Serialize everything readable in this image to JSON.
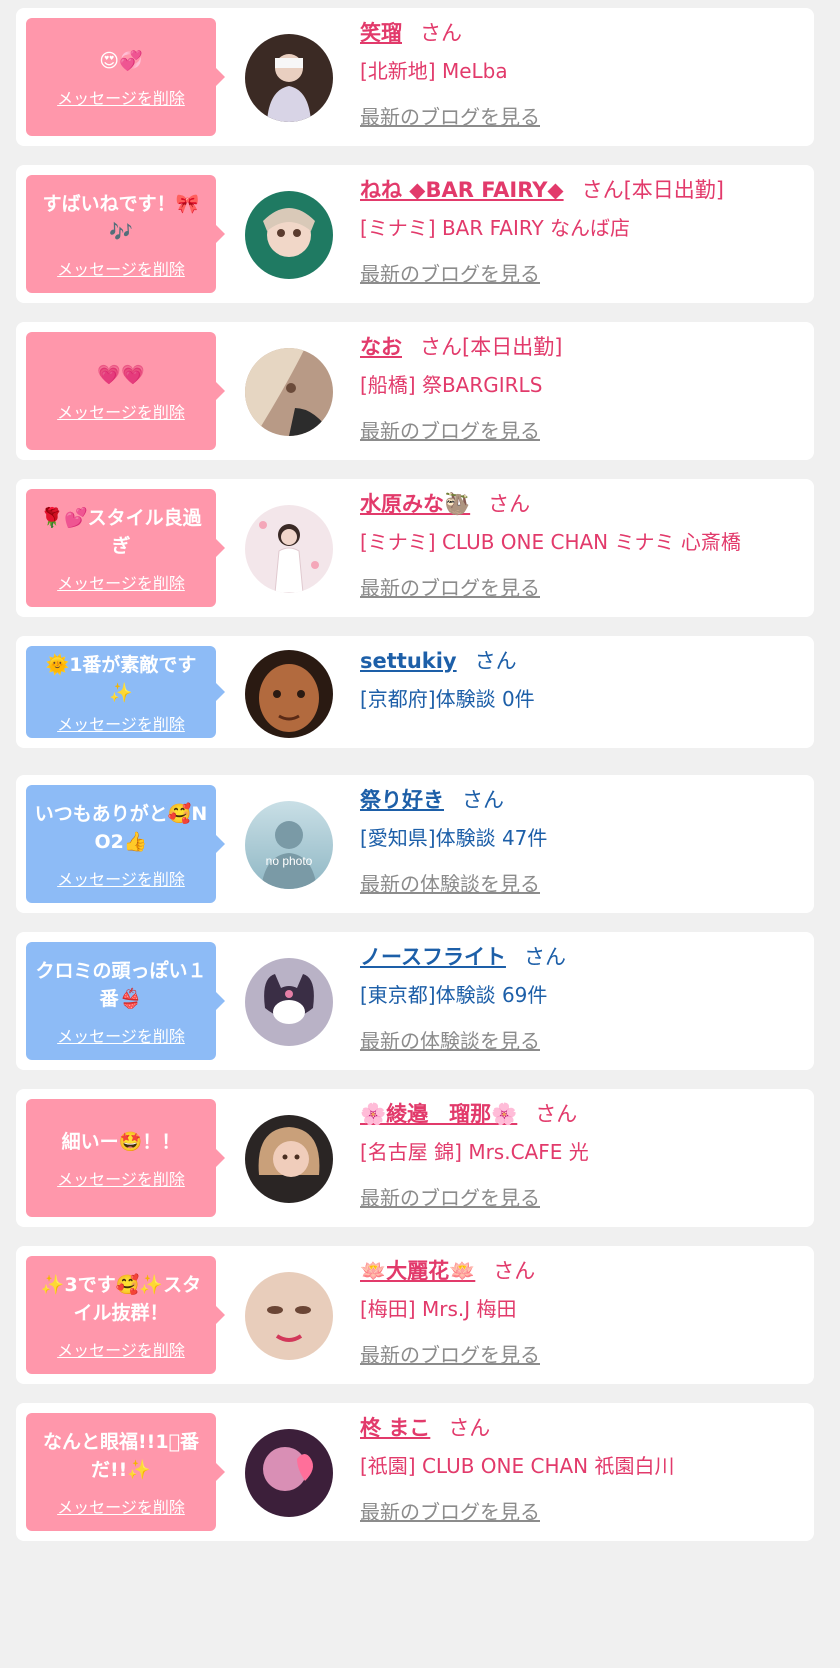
{
  "colors": {
    "pink_bubble": "#ff97ab",
    "blue_bubble": "#8dbbf6",
    "pink_text": "#e23a6b",
    "blue_text": "#1d5fa8",
    "link_gray": "#8c8c8c",
    "page_bg": "#f0f0f0"
  },
  "delete_label": "メッセージを削除",
  "cards": [
    {
      "theme": "pink",
      "message": "😍💞",
      "name": "笑瑠",
      "suffix": "さん",
      "shop": "[北新地] MeLba",
      "link": "最新のブログを見る",
      "avatar": "girl-photo-icon"
    },
    {
      "theme": "pink",
      "message": "すばいねです！🎀🎶",
      "name": "ねね ◆BAR FAIRY◆",
      "suffix": "さん[本日出勤]",
      "shop": "[ミナミ] BAR FAIRY なんば店",
      "link": "最新のブログを見る",
      "avatar": "girl-photo-icon"
    },
    {
      "theme": "pink",
      "message": "💗💗",
      "name": "なお",
      "suffix": "さん[本日出勤]",
      "shop": "[船橋] 祭BARGIRLS",
      "link": "最新のブログを見る",
      "avatar": "girl-photo-icon"
    },
    {
      "theme": "pink",
      "message": "🌹💕スタイル良過ぎ",
      "name": "水原みな🦥",
      "suffix": "さん",
      "shop": "[ミナミ] CLUB ONE CHAN ミナミ 心斎橋",
      "link": "最新のブログを見る",
      "avatar": "girl-photo-icon"
    },
    {
      "theme": "blue",
      "message": "🌞1番が素敵です✨",
      "name": "settukiy",
      "suffix": "さん",
      "shop": "[京都府]体験談 0件",
      "link": "",
      "avatar": "man-photo-icon"
    },
    {
      "theme": "blue",
      "message": "いつもありがと🥰NO2👍",
      "name": "祭り好き",
      "suffix": "さん",
      "shop": "[愛知県]体験談 47件",
      "link": "最新の体験談を見る",
      "avatar": "no-photo-icon",
      "avatar_text": "no photo"
    },
    {
      "theme": "blue",
      "message": "クロミの頭っぽい１番👙",
      "name": "ノースフライト",
      "suffix": "さん",
      "shop": "[東京都]体験談 69件",
      "link": "最新の体験談を見る",
      "avatar": "kuromi-icon"
    },
    {
      "theme": "pink",
      "message": "細いー🤩！！",
      "name": "🌸綾邉　瑠那🌸",
      "suffix": "さん",
      "shop": "[名古屋 錦] Mrs.CAFE 光",
      "link": "最新のブログを見る",
      "avatar": "girl-photo-icon"
    },
    {
      "theme": "pink",
      "message": "✨3です🥰✨スタイル抜群！",
      "name": "🪷大麗花🪷",
      "suffix": "さん",
      "shop": "[梅田] Mrs.J 梅田",
      "link": "最新のブログを見る",
      "avatar": "girl-photo-icon"
    },
    {
      "theme": "pink",
      "message": "なんと眼福!!1⃣番だ!!✨",
      "name": "柊 まこ",
      "suffix": "さん",
      "shop": "[祇園] CLUB ONE CHAN 祇園白川",
      "link": "最新のブログを見る",
      "avatar": "girl-photo-icon"
    }
  ]
}
